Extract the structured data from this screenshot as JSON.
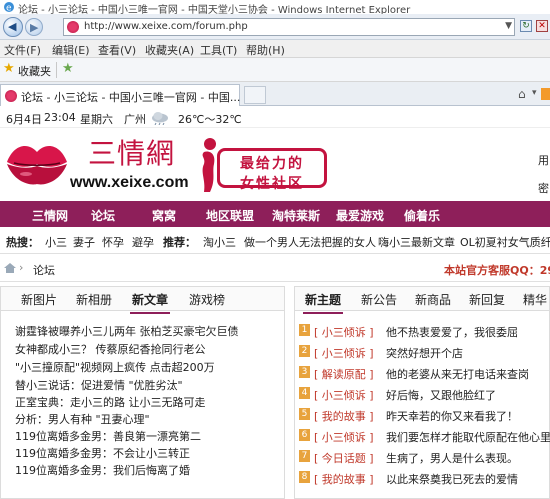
{
  "browser": {
    "window_title": "论坛 - 小三论坛 - 中国小三唯一官网 - 中国天堂小三协会 - Windows Internet Explorer",
    "url": "http://www.xeixe.com/forum.php",
    "menu": [
      "文件(F)",
      "编辑(E)",
      "查看(V)",
      "收藏夹(A)",
      "工具(T)",
      "帮助(H)"
    ],
    "favorites_label": "收藏夹",
    "tab_title": "论坛 - 小三论坛 - 中国小三唯一官网 - 中国..."
  },
  "topinfo": {
    "date": "6月4日",
    "time": "23:04",
    "weekday": "星期六",
    "city": "广州",
    "temp": "26℃～32℃"
  },
  "header": {
    "site_name": "三情網",
    "site_url": "www.xeixe.com",
    "slogan_line1": "最给力的",
    "slogan_line2": "女性社区",
    "right_text_1": "用",
    "right_text_2": "密"
  },
  "nav": [
    "三情网",
    "论坛",
    "窝窝",
    "地区联盟",
    "淘特莱斯",
    "最爱游戏",
    "偷着乐"
  ],
  "hot": {
    "label": "热搜：",
    "items": [
      "小三",
      "妻子",
      "怀孕",
      "避孕"
    ],
    "recommend_label": "推荐：",
    "recommend_items": [
      "淘小三",
      "做一个男人无法把握的女人",
      "嗨小三最新文章",
      "OL初夏衬女气质纤"
    ]
  },
  "breadcrumb": {
    "forum": "论坛",
    "qq_text": "本站官方客服QQ：29"
  },
  "left_panel": {
    "tabs": [
      "新图片",
      "新相册",
      "新文章",
      "游戏榜"
    ],
    "active_tab": 2,
    "items": [
      "谢霆锋被曝养小三儿两年 张柏芝买豪宅欠巨债",
      "女神都成小三？ 传蔡原纪香抢同行老公",
      "\"小三撞原配\"视频网上疯传 点击超200万",
      "替小三说话：促进爱情 \"优胜劣汰\"",
      "正室宝典：走小三的路 让小三无路可走",
      "分析：男人有种 \"丑妻心理\"",
      "119位离婚多金男：善良第一漂亮第二",
      "119位离婚多金男：不会让小三转正",
      "119位离婚多金男：我们后悔离了婚"
    ]
  },
  "right_panel": {
    "tabs": [
      "新主题",
      "新公告",
      "新商品",
      "新回复",
      "精华"
    ],
    "active_tab": 0,
    "items": [
      {
        "num": "1",
        "tag": "[ 小三倾诉 ]",
        "text": "他不热衷爱爱了，我很委屈"
      },
      {
        "num": "2",
        "tag": "[ 小三倾诉 ]",
        "text": "突然好想开个店"
      },
      {
        "num": "3",
        "tag": "[ 解读原配 ]",
        "text": "他的老婆从来无打电话来查岗"
      },
      {
        "num": "4",
        "tag": "[ 小三倾诉 ]",
        "text": "好后悔，又跟他脸红了"
      },
      {
        "num": "5",
        "tag": "[ 我的故事 ]",
        "text": "昨天幸若的你又来看我了！"
      },
      {
        "num": "6",
        "tag": "[ 小三倾诉 ]",
        "text": "我们要怎样才能取代原配在他心里的"
      },
      {
        "num": "7",
        "tag": "[ 今日话题 ]",
        "text": "生病了，男人是什么表现。"
      },
      {
        "num": "8",
        "tag": "[ 我的故事 ]",
        "text": "以此来祭奠我已死去的爱情"
      }
    ]
  }
}
